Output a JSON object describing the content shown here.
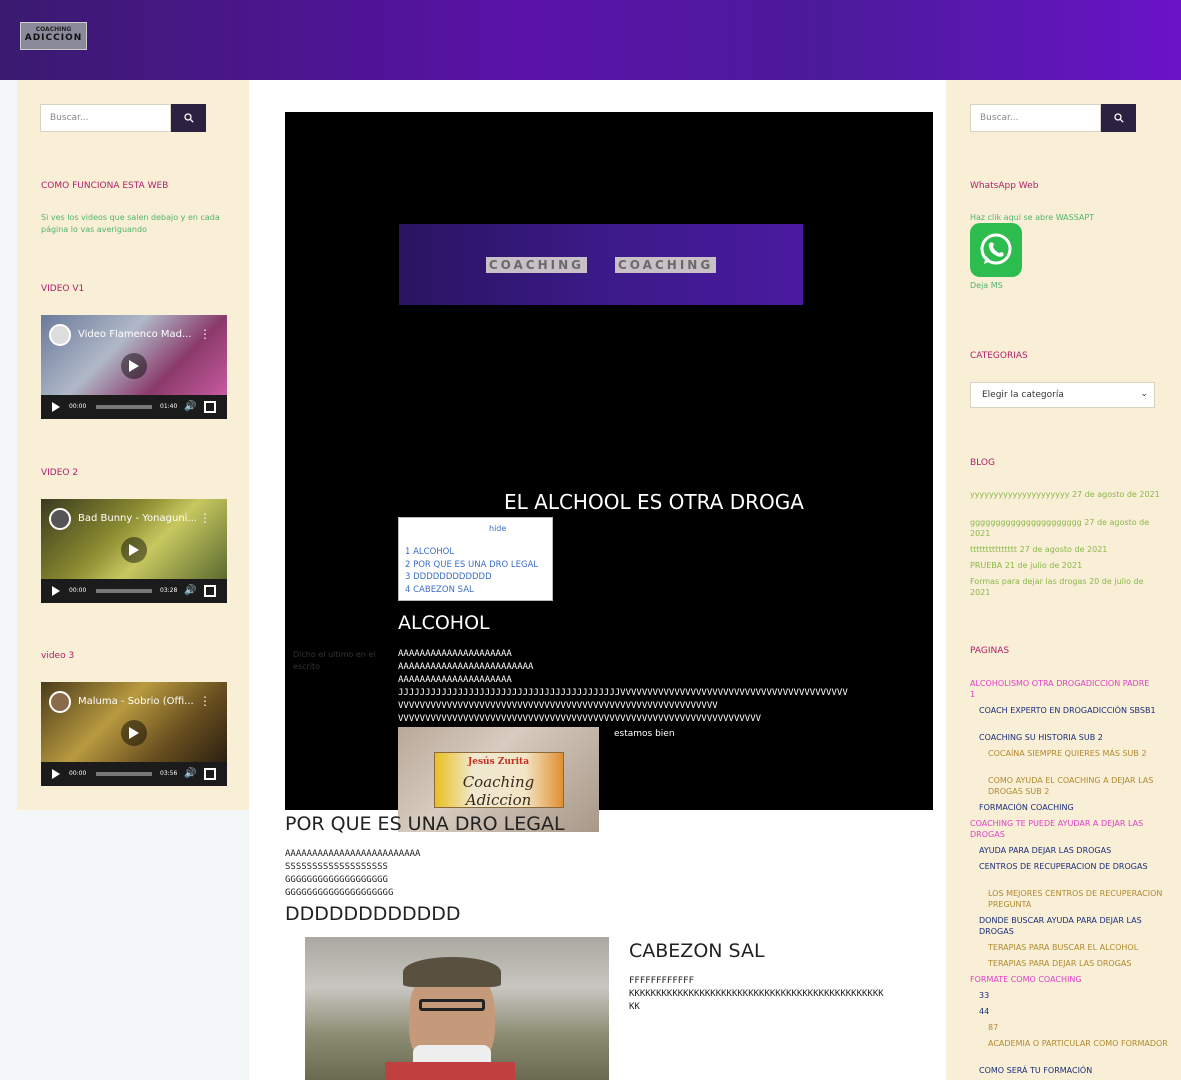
{
  "header": {
    "logo_line1": "COACHING",
    "logo_line2": "ADICCION"
  },
  "left_sidebar": {
    "search_placeholder": "Buscar...",
    "how_title": "COMO FUNCIONA ESTA WEB",
    "how_text": "Si ves los videos que salen debajo y en cada página lo vas averiguando",
    "videos": [
      {
        "section": "VIDEO V1",
        "title": "Video Flamenco Mad...",
        "current": "00:00",
        "duration": "01:40"
      },
      {
        "section": "VIDEO 2",
        "title": "Bad Bunny - Yonaguni...",
        "current": "00:00",
        "duration": "03:28"
      },
      {
        "section": "video 3",
        "title": "Maluma - Sobrio (Offi...",
        "current": "00:00",
        "duration": "03:56"
      }
    ]
  },
  "main": {
    "banner": [
      "COACHING",
      "COACHING"
    ],
    "title": "EL ALCHOOL ES OTRA DROGA",
    "toc": {
      "hide": "hide",
      "items": [
        "1 ALCOHOL",
        "2 POR QUE ES UNA DRO LEGAL",
        "3 DDDDDDDDDDDD",
        "4 CABEZON SAL"
      ]
    },
    "faint_text": "Dicho el ultimo en el escrito",
    "alcohol": {
      "heading": "ALCOHOL",
      "lines": [
        "AAAAAAAAAAAAAAAAAAAAA",
        "AAAAAAAAAAAAAAAAAAAAAAAAA",
        "AAAAAAAAAAAAAAAAAAAAA",
        "JJJJJJJJJJJJJJJJJJJJJJJJJJJJJJJJJJJJJJJJJVVVVVVVVVVVVVVVVVVVVVVVVVVVVVVVVVVVVVVVVVV",
        "VVVVVVVVVVVVVVVVVVVVVVVVVVVVVVVVVVVVVVVVVVVVVVVVVVVVVVVVVVV",
        "VVVVVVVVVVVVVVVVVVVVVVVVVVVVVVVVVVVVVVVVVVVVVVVVVVVVVVVVVVVVVVVVVVV"
      ]
    },
    "image_card": {
      "line1": "Jesús Zurita",
      "line2": "Coaching Adiccion"
    },
    "estamos": "estamos bien",
    "legal": {
      "heading": "POR QUE ES UNA DRO LEGAL",
      "lines": [
        "AAAAAAAAAAAAAAAAAAAAAAAAA",
        "SSSSSSSSSSSSSSSSSSS",
        "GGGGGGGGGGGGGGGGGGG",
        "GGGGGGGGGGGGGGGGGGGG"
      ]
    },
    "dddd": {
      "heading": "DDDDDDDDDDDD"
    },
    "cabezon": {
      "heading": "CABEZON SAL",
      "lines": [
        "FFFFFFFFFFFF",
        "KKKKKKKKKKKKKKKKKKKKKKKKKKKKKKKKKKKKKKKKKKKKKKK",
        "KK"
      ]
    }
  },
  "right_sidebar": {
    "search_placeholder": "Buscar...",
    "whatsapp_title": "WhatsApp Web",
    "whatsapp_text": "Haz clik aqui se abre WASSAPT",
    "whatsapp_caption": "Deja MS",
    "categories_title": "CATEGORIAS",
    "categories_selected": "Elegir la categoría",
    "blog_title": "BLOG",
    "blog": [
      {
        "title": "yyyyyyyyyyyyyyyyyyyyy",
        "date": "27 de agosto de 2021"
      },
      {
        "title": "gggggggggggggggggggggg",
        "date": "27 de agosto de 2021"
      },
      {
        "title": "ttttttttttttttt",
        "date": "27 de agosto de 2021"
      },
      {
        "title": "PRUEBA",
        "date": "21 de julio de 2021"
      },
      {
        "title": "Formas para dejar las drogas",
        "date": "20 de julio de 2021"
      }
    ],
    "pages_title": "PAGINAS",
    "pages": [
      {
        "label": "ALCOHOLISMO OTRA DROGADICCION PADRE 1",
        "level": 1
      },
      {
        "label": "COACH EXPERTO EN DROGADICCIÓN SBSB1",
        "level": 2
      },
      {
        "label": "COACHING SU HISTORIA SUB 2",
        "level": 2
      },
      {
        "label": "COCAÍNA SIEMPRE QUIERES MÁS SUB 2",
        "level": 3
      },
      {
        "label": "COMO AYUDA EL COACHING A DEJAR LAS DROGAS SUB 2",
        "level": 3
      },
      {
        "label": "FORMACIÓN COACHING",
        "level": 2
      },
      {
        "label": "COACHING TE PUEDE AYUDAR A DEJAR LAS DROGAS",
        "level": 1
      },
      {
        "label": "AYUDA PARA DEJAR LAS DROGAS",
        "level": 2
      },
      {
        "label": "CENTROS DE RECUPERACION DE DROGAS",
        "level": 2
      },
      {
        "label": "LOS MEJORES CENTROS DE RECUPERACION PREGUNTA",
        "level": 3
      },
      {
        "label": "DONDE BUSCAR AYUDA PARA DEJAR LAS DROGAS",
        "level": 2
      },
      {
        "label": "TERAPIAS PARA BUSCAR EL ALCOHOL",
        "level": 3
      },
      {
        "label": "TERAPIAS PARA DEJAR LAS DROGAS",
        "level": 3
      },
      {
        "label": "FORMATE COMO COACHING",
        "level": 1
      },
      {
        "label": "33",
        "level": 2
      },
      {
        "label": "44",
        "level": 2
      },
      {
        "label": "87",
        "level": 3
      },
      {
        "label": "ACADEMIA O PARTICULAR COMO FORMADOR",
        "level": 3
      },
      {
        "label": "COMO SERÁ TU FORMACIÓN",
        "level": 2
      }
    ]
  }
}
